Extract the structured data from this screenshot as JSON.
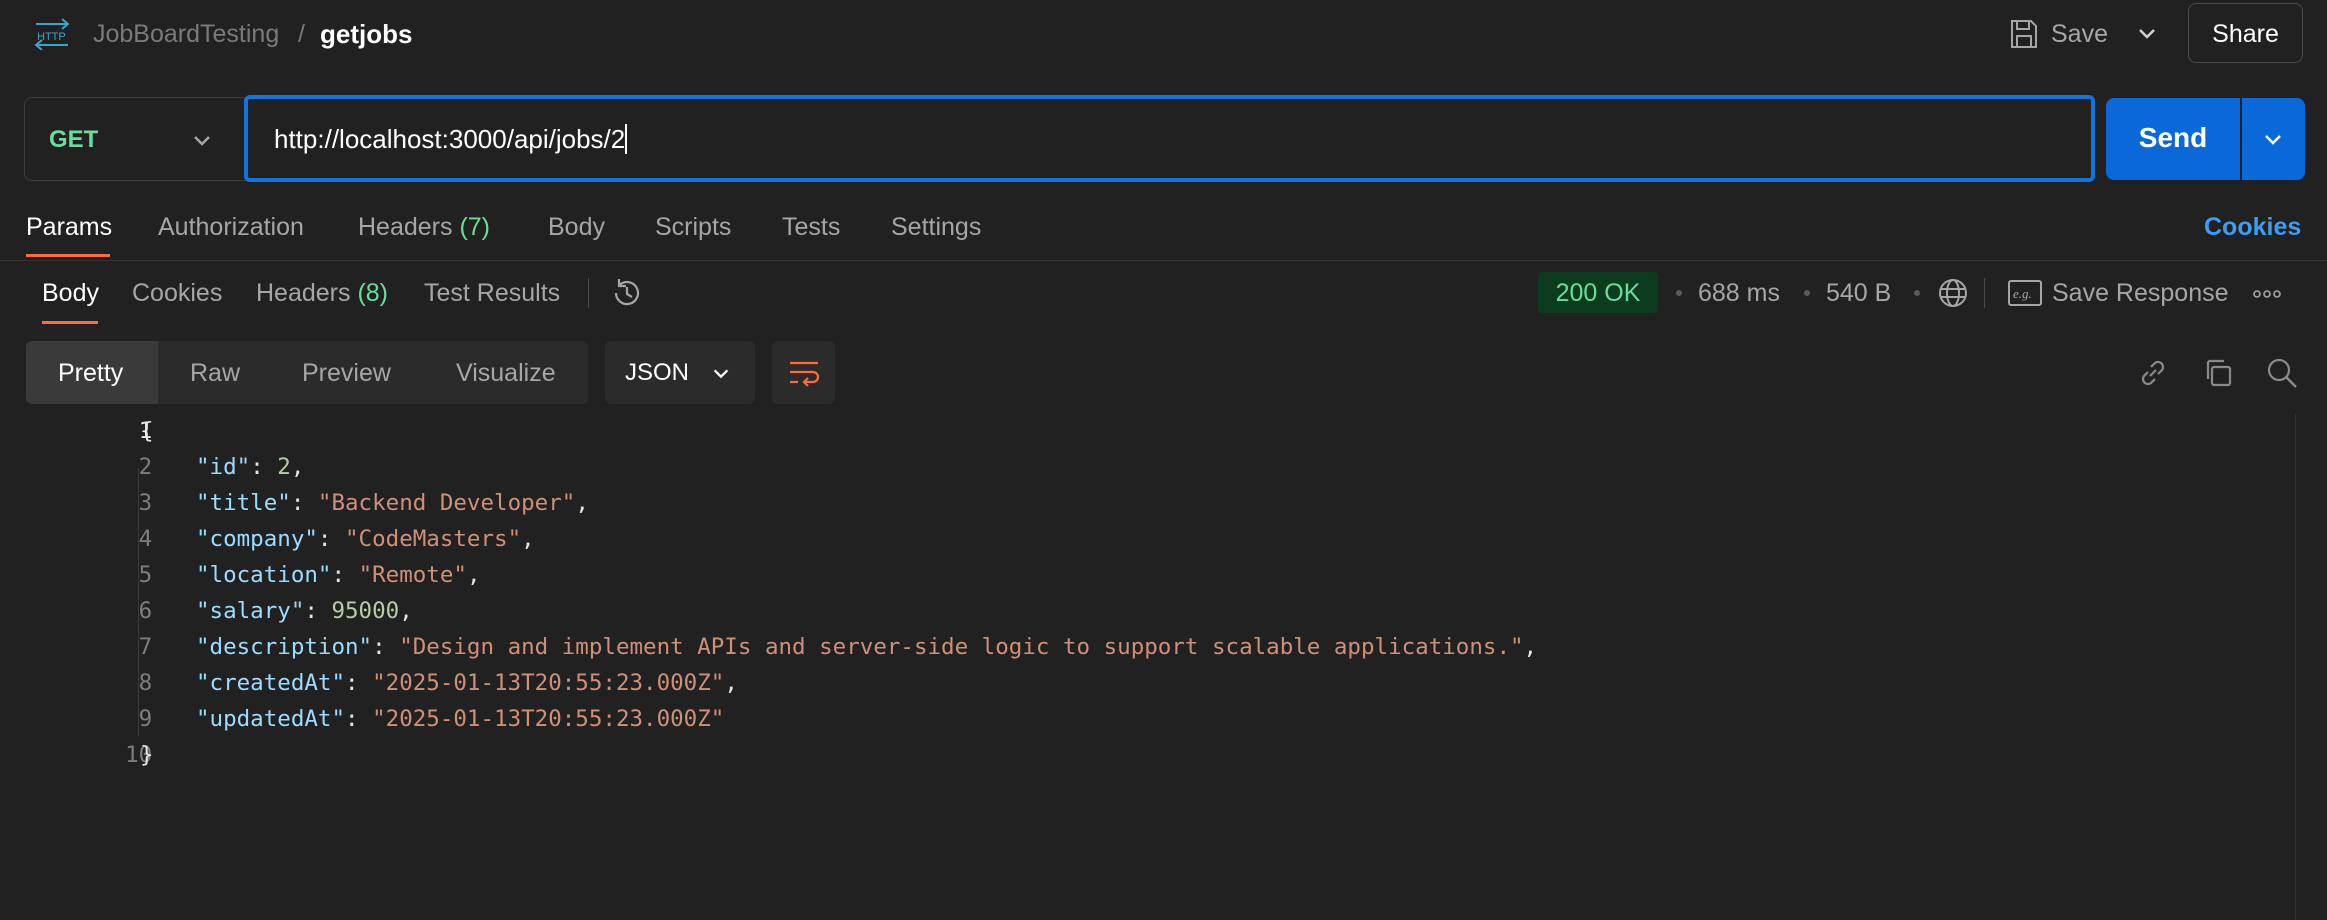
{
  "breadcrumb": {
    "collection": "JobBoardTesting",
    "separator": "/",
    "request": "getjobs"
  },
  "header": {
    "save_label": "Save",
    "share_label": "Share"
  },
  "request": {
    "method": "GET",
    "url": "http://localhost:3000/api/jobs/2",
    "send_label": "Send"
  },
  "request_tabs": {
    "params": "Params",
    "authorization": "Authorization",
    "headers": "Headers",
    "headers_count": "(7)",
    "body": "Body",
    "scripts": "Scripts",
    "tests": "Tests",
    "settings": "Settings",
    "cookies": "Cookies"
  },
  "response_tabs": {
    "body": "Body",
    "cookies": "Cookies",
    "headers": "Headers",
    "headers_count": "(8)",
    "test_results": "Test Results"
  },
  "response_meta": {
    "status": "200 OK",
    "time": "688 ms",
    "size": "540 B",
    "save_response": "Save Response"
  },
  "view_modes": {
    "pretty": "Pretty",
    "raw": "Raw",
    "preview": "Preview",
    "visualize": "Visualize",
    "format": "JSON"
  },
  "colors": {
    "accent": "#ff6c37",
    "send": "#0b68d9",
    "method": "#6bdd9a",
    "link": "#3e9cf5"
  },
  "icons": [
    "http-logo-icon",
    "save-icon",
    "chevron-down-icon",
    "history-icon",
    "globe-icon",
    "example-icon",
    "more-icon",
    "wrap-icon",
    "link-icon",
    "copy-icon",
    "search-icon"
  ],
  "code": {
    "line_numbers": [
      "1",
      "2",
      "3",
      "4",
      "5",
      "6",
      "7",
      "8",
      "9",
      "10"
    ],
    "open": "{",
    "close": "}",
    "fields": [
      {
        "key": "\"id\"",
        "value": "2",
        "type": "number",
        "comma": ","
      },
      {
        "key": "\"title\"",
        "value": "\"Backend Developer\"",
        "type": "string",
        "comma": ","
      },
      {
        "key": "\"company\"",
        "value": "\"CodeMasters\"",
        "type": "string",
        "comma": ","
      },
      {
        "key": "\"location\"",
        "value": "\"Remote\"",
        "type": "string",
        "comma": ","
      },
      {
        "key": "\"salary\"",
        "value": "95000",
        "type": "number",
        "comma": ","
      },
      {
        "key": "\"description\"",
        "value": "\"Design and implement APIs and server-side logic to support scalable applications.\"",
        "type": "string",
        "comma": ","
      },
      {
        "key": "\"createdAt\"",
        "value": "\"2025-01-13T20:55:23.000Z\"",
        "type": "string",
        "comma": ","
      },
      {
        "key": "\"updatedAt\"",
        "value": "\"2025-01-13T20:55:23.000Z\"",
        "type": "string",
        "comma": ""
      }
    ]
  }
}
